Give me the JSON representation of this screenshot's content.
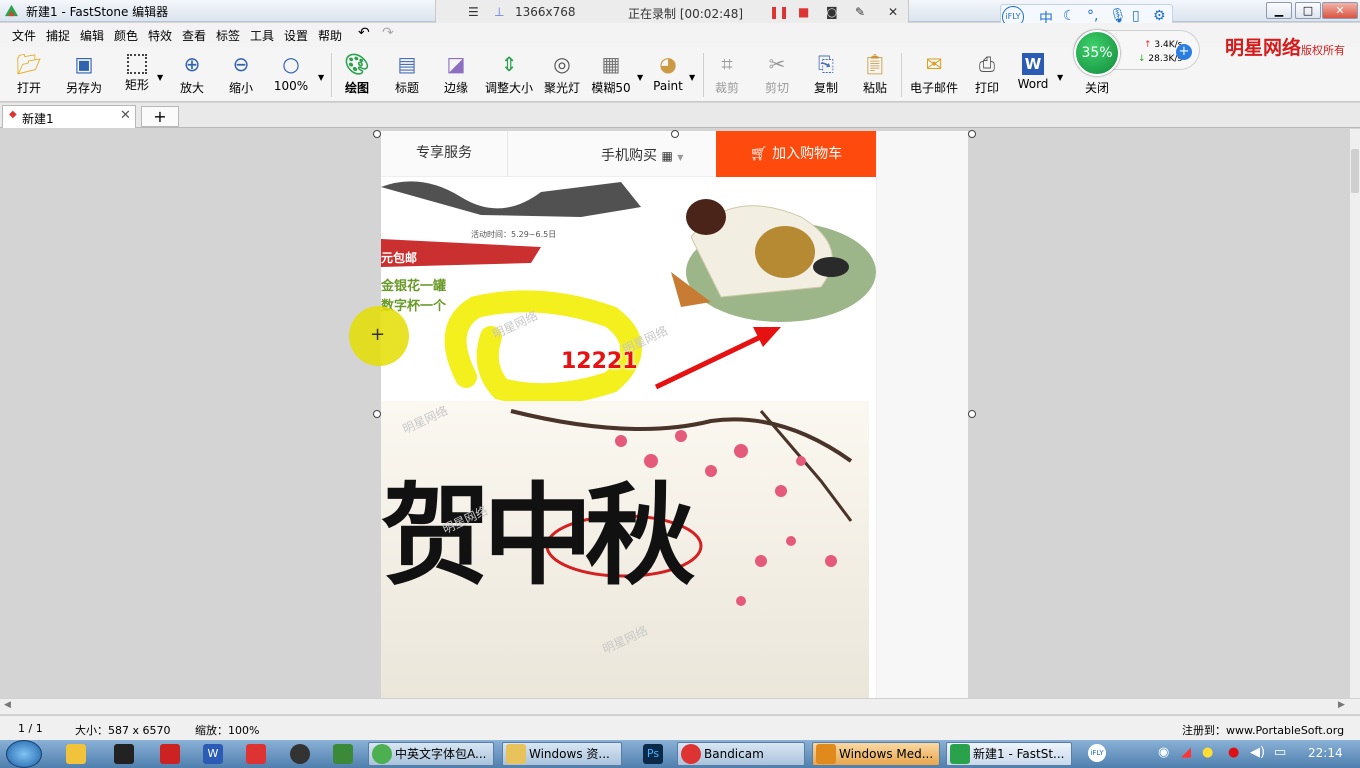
{
  "window": {
    "title": "新建1 - FastStone 编辑器"
  },
  "recorder": {
    "resolution": "1366x768",
    "status": "正在录制 [00:02:48]"
  },
  "ifly": {
    "logo": "iFLY",
    "lang": "中"
  },
  "menu": [
    "文件",
    "捕捉",
    "编辑",
    "颜色",
    "特效",
    "查看",
    "标签",
    "工具",
    "设置",
    "帮助"
  ],
  "toolbar": {
    "open": "打开",
    "save_as": "另存为",
    "rect": "矩形",
    "zoom_in": "放大",
    "zoom_out": "缩小",
    "zoom": "100%",
    "draw": "绘图",
    "caption": "标题",
    "edge": "边缘",
    "resize": "调整大小",
    "spotlight": "聚光灯",
    "blur": "模糊50",
    "paint": "Paint",
    "crop": "裁剪",
    "cut": "剪切",
    "copy": "复制",
    "paste": "粘贴",
    "email": "电子邮件",
    "print": "打印",
    "word": "Word",
    "close": "关闭"
  },
  "netmeter": {
    "percent": "35%",
    "up": "3.4K/s",
    "down": "28.3K/s"
  },
  "brand": {
    "name": "明星网络",
    "suffix": "版权所有"
  },
  "tabs": [
    {
      "label": "新建1"
    }
  ],
  "page": {
    "nav_service": "专享服务",
    "nav_phone": "手机购买",
    "nav_cart": "加入购物车",
    "promo_date": "活动时间：5.29~6.5日",
    "promo_ship": "元包邮",
    "promo_line1": "金银花一罐",
    "promo_line2": "数字杯一个",
    "annotation_number": "12221",
    "big_text": "贺中秋",
    "watermark": "明星网络"
  },
  "status": {
    "page": "1 / 1",
    "size": "大小：587 x 6570",
    "zoom": "缩放：100%",
    "reg": "注册到：www.PortableSoft.org"
  },
  "taskbar": {
    "items": [
      "中英文字体包A...",
      "Windows 资...",
      "Bandicam",
      "Windows Med...",
      "新建1 - FastSt..."
    ],
    "clock": "22:14"
  },
  "colors": {
    "cart": "#ff4a0d",
    "highlight": "#f2ee05",
    "arrow": "#e61111",
    "brand": "#d41c1c"
  }
}
